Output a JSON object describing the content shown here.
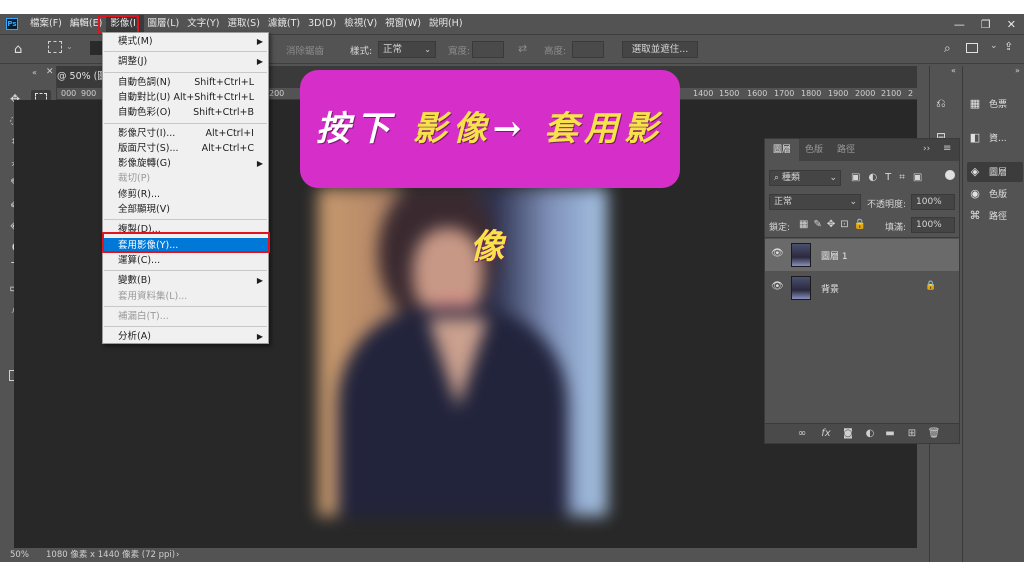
{
  "menubar": {
    "items": [
      "檔案(F)",
      "編輯(E)",
      "影像(I)",
      "圖層(L)",
      "文字(Y)",
      "選取(S)",
      "濾鏡(T)",
      "3D(D)",
      "檢視(V)",
      "視窗(W)",
      "說明(H)"
    ],
    "active_index": 2,
    "logo": "Ps"
  },
  "window_controls": [
    "—",
    "❐",
    "✕"
  ],
  "options_bar": {
    "anti_alias_label": "消除鋸齒",
    "style_label": "樣式:",
    "style_value": "正常",
    "width_label": "寬度:",
    "height_label": "高度:",
    "select_mask_button": "選取並遮住..."
  },
  "document": {
    "tab_title": "@ 50% (圖",
    "ruler_ticks_left": [
      "000",
      "900"
    ],
    "ruler_ticks_right": [
      "1400",
      "1500",
      "1600",
      "1700",
      "1800",
      "1900",
      "2000",
      "2100",
      "2"
    ],
    "ruler_tick_200": "200",
    "zoom": "50%",
    "doc_info": "1080 像素 x 1440 像素 (72 ppi)"
  },
  "image_menu": {
    "items": [
      {
        "label": "模式(M)",
        "submenu": true
      },
      {
        "sep": true
      },
      {
        "label": "調整(J)",
        "submenu": true
      },
      {
        "sep": true
      },
      {
        "label": "自動色調(N)",
        "shortcut": "Shift+Ctrl+L"
      },
      {
        "label": "自動對比(U)",
        "shortcut": "Alt+Shift+Ctrl+L"
      },
      {
        "label": "自動色彩(O)",
        "shortcut": "Shift+Ctrl+B"
      },
      {
        "sep": true
      },
      {
        "label": "影像尺寸(I)...",
        "shortcut": "Alt+Ctrl+I"
      },
      {
        "label": "版面尺寸(S)...",
        "shortcut": "Alt+Ctrl+C"
      },
      {
        "label": "影像旋轉(G)",
        "submenu": true
      },
      {
        "label": "裁切(P)",
        "disabled": true
      },
      {
        "label": "修剪(R)..."
      },
      {
        "label": "全部顯現(V)"
      },
      {
        "sep": true
      },
      {
        "label": "複製(D)..."
      },
      {
        "label": "套用影像(Y)...",
        "highlighted": true
      },
      {
        "label": "運算(C)..."
      },
      {
        "sep": true
      },
      {
        "label": "變數(B)",
        "submenu": true
      },
      {
        "label": "套用資料集(L)...",
        "disabled": true
      },
      {
        "sep": true
      },
      {
        "label": "補漏白(T)...",
        "disabled": true
      },
      {
        "sep": true
      },
      {
        "label": "分析(A)",
        "submenu": true
      }
    ]
  },
  "annotation": {
    "part1": "按下",
    "part2": "影像",
    "arrow": "→",
    "part3": "套用影像",
    "bg_color": "#d62ec8"
  },
  "layers_panel": {
    "tabs": [
      "圖層",
      "色版",
      "路徑"
    ],
    "filter_label": "種類",
    "blend_mode": "正常",
    "opacity_label": "不透明度:",
    "opacity_value": "100%",
    "lock_label": "鎖定:",
    "fill_label": "填滿:",
    "fill_value": "100%",
    "layers": [
      {
        "name": "圖層 1",
        "selected": true
      },
      {
        "name": "背景",
        "locked": true
      }
    ]
  },
  "dock": {
    "col1_icons": [
      "history-icon",
      "properties-icon"
    ],
    "col2_items": [
      {
        "label": "色票",
        "icon": "swatches-icon"
      },
      {
        "label": "資...",
        "icon": "libraries-icon"
      },
      {
        "label": "圖層",
        "icon": "layers-icon",
        "active": true
      },
      {
        "label": "色版",
        "icon": "channels-icon"
      },
      {
        "label": "路徑",
        "icon": "paths-icon"
      }
    ]
  },
  "colors": {
    "ui_gray": "#535353",
    "canvas_bg": "#282828",
    "highlight_blue": "#0078d7",
    "annotation_red": "#e0141e"
  }
}
